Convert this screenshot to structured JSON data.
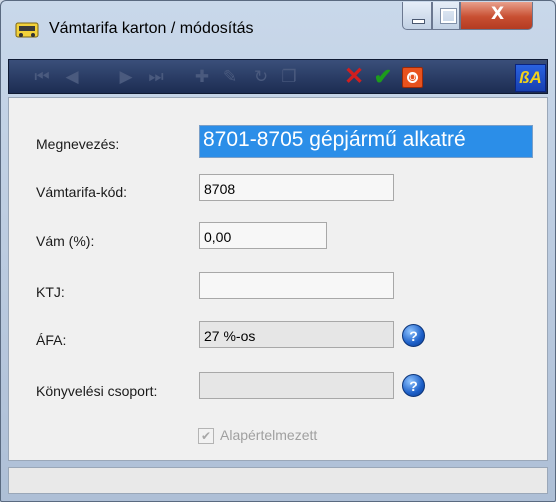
{
  "window": {
    "title": "Vámtarifa karton / módosítás",
    "close_label": "X"
  },
  "toolbar": {
    "items": [
      {
        "name": "first-record",
        "icon": "first-icon",
        "glyph": "⏮",
        "enabled": false
      },
      {
        "name": "prev-record",
        "icon": "prev-icon",
        "glyph": "◀",
        "enabled": false
      },
      {
        "name": "next-record",
        "icon": "next-icon",
        "glyph": "▶",
        "enabled": false
      },
      {
        "name": "last-record",
        "icon": "last-icon",
        "glyph": "⏭",
        "enabled": false
      },
      {
        "name": "new-record",
        "icon": "new-doc-icon",
        "glyph": "✚",
        "enabled": false
      },
      {
        "name": "edit-record",
        "icon": "edit-icon",
        "glyph": "✎",
        "enabled": false
      },
      {
        "name": "refresh-record",
        "icon": "refresh-icon",
        "glyph": "↻",
        "enabled": false
      },
      {
        "name": "copy-record",
        "icon": "copy-icon",
        "glyph": "❐",
        "enabled": false
      }
    ],
    "cancel_glyph": "✕",
    "ok_glyph": "✔",
    "stop_glyph": "O",
    "lang_label": "ßA"
  },
  "form": {
    "megnevezes_label": "Megnevezés:",
    "megnevezes_value": "8701-8705 gépjármű alkatré",
    "kod_label": "Vámtarifa-kód:",
    "kod_value": "8708",
    "vam_label": "Vám (%):",
    "vam_value": "0,00",
    "ktj_label": "KTJ:",
    "ktj_value": "",
    "afa_label": "ÁFA:",
    "afa_value": "27 %-os",
    "konyv_label": "Könyvelési csoport:",
    "konyv_value": "",
    "help_glyph": "?",
    "alap_label": "Alapértelmezett",
    "alap_checked": "✔"
  },
  "colors": {
    "toolbar_bg": "#1c2c52",
    "highlight": "#2b8ee8",
    "cancel": "#d21e1e",
    "ok": "#1c9c1c"
  }
}
